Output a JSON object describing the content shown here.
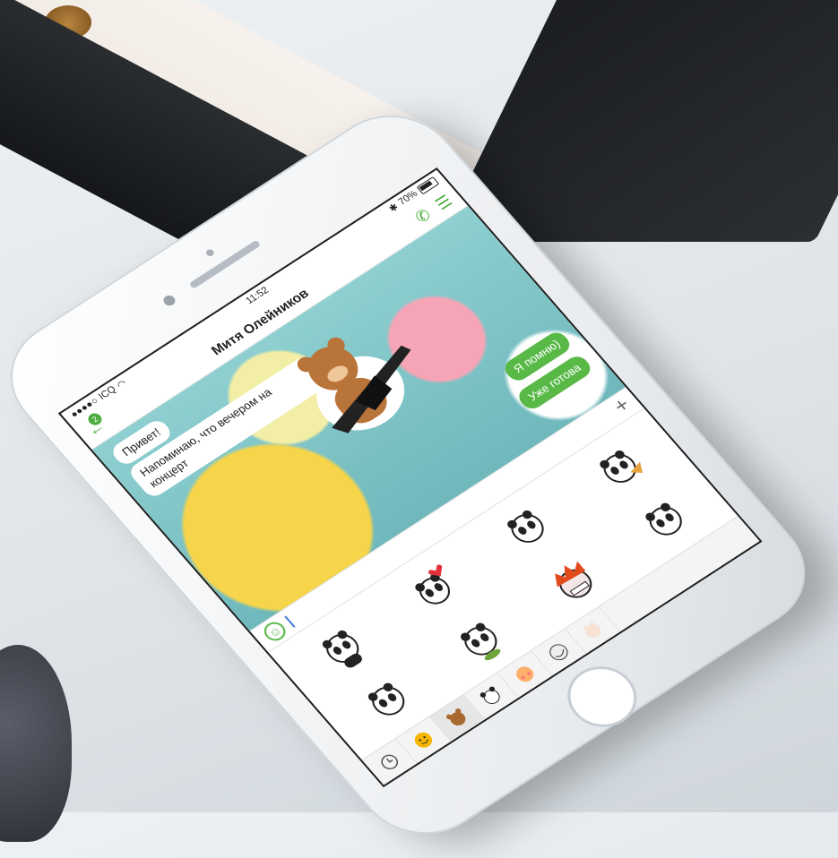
{
  "status_bar": {
    "carrier": "ICQ",
    "time": "11:52",
    "battery": "70%"
  },
  "header": {
    "back_badge": "2",
    "contact_name": "Митя Олейников"
  },
  "messages": [
    {
      "direction": "in",
      "text": "Привет!"
    },
    {
      "direction": "in",
      "text": "Напоминаю, что вечером на концерт"
    },
    {
      "direction": "out",
      "text": "Я помню)"
    },
    {
      "direction": "out",
      "text": "Уже готова"
    }
  ],
  "input": {
    "value": ""
  },
  "sticker_panel": {
    "stickers": [
      "panda-sticker",
      "panda-heart-sticker",
      "panda-sticker",
      "panda-sticker",
      "panda-sticker",
      "panda-sticker",
      "angry-face-sticker",
      "panda-sticker"
    ],
    "page_count": 4,
    "active_page": 2,
    "packs": [
      "clock-icon",
      "smiley-pack",
      "bear-pack",
      "panda-pack",
      "emoji-pack",
      "troll-pack",
      "cat-pack"
    ]
  },
  "colors": {
    "accent": "#58b947",
    "bubble_out": "#58b947",
    "bubble_in": "#ffffff"
  }
}
